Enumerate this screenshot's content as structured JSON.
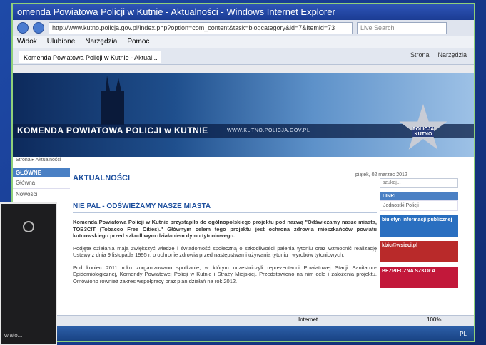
{
  "window": {
    "title": "omenda Powiatowa Policji w Kutnie - Aktualności - Windows Internet Explorer",
    "url": "http://www.kutno.policja.gov.pl/index.php?option=com_content&task=blogcategory&id=7&Itemid=73",
    "search_placeholder": "Live Search"
  },
  "menu": [
    "Widok",
    "Ulubione",
    "Narzędzia",
    "Pomoc"
  ],
  "tab": {
    "label": "Komenda Powiatowa Policji w Kutnie - Aktual..."
  },
  "toolbar": {
    "strona": "Strona",
    "narzedzia": "Narzędzia"
  },
  "banner": {
    "title": "KOMENDA POWIATOWA POLICJI w KUTNIE",
    "site_url": "WWW.KUTNO.POLICJA.GOV.PL",
    "badge": "POLICJA KUTNO"
  },
  "breadcrumb": "Strona ▸ Aktualności",
  "left_menu": {
    "head": "GŁÓWNE",
    "items": [
      "Główna",
      "Nowości"
    ]
  },
  "main": {
    "date": "piątek, 02 marzec 2012",
    "section": "AKTUALNOŚCI",
    "headline": "NIE PAL - ODŚWIEŻAMY NASZE MIASTA",
    "para1": "Komenda Powiatowa Policji w Kutnie przystąpiła do ogólnopolskiego projektu pod nazwą \"Odświeżamy nasze miasta, TOB3CIT (Tobacco Free Cities).\" Głównym celem tego projektu jest ochrona zdrowia mieszkańców powiatu kutnowskiego przed szkodliwym działaniem dymu tytoniowego.",
    "para2": "Podjęte działania mają zwiększyć wiedzę i świadomość społeczną o szkodliwości palenia tytoniu oraz wzmocnić realizację Ustawy z dnia 9 listopada 1995 r. o ochronie zdrowia przed następstwami używania tytoniu i wyrobów tytoniowych.",
    "para3": "Pod koniec 2011 roku zorganizowano spotkanie, w którym uczestniczyli reprezentanci Powiatowej Stacji Sanitarno-Epidemiologicznej, Komendy Powiatowej Policji w Kutnie i Straży Miejskiej. Przedstawiono na nim cele i założenia projektu. Omówiono również zakres współpracy oraz plan działań na rok 2012."
  },
  "right_col": {
    "search": "szukaj...",
    "links_head": "LINKI",
    "link1": "Jednostki Policji",
    "promo1": "biuletyn informacji publicznej",
    "promo2": "kbic@wsieci.pl",
    "promo3": "BEZPIECZNA SZKOŁA",
    "promo_colors": [
      "#2a6fc0",
      "#b92a2a",
      "#c2183a"
    ]
  },
  "status": {
    "internet": "Internet",
    "zoom": "100%"
  },
  "overlay": {
    "text": "wiato..."
  }
}
